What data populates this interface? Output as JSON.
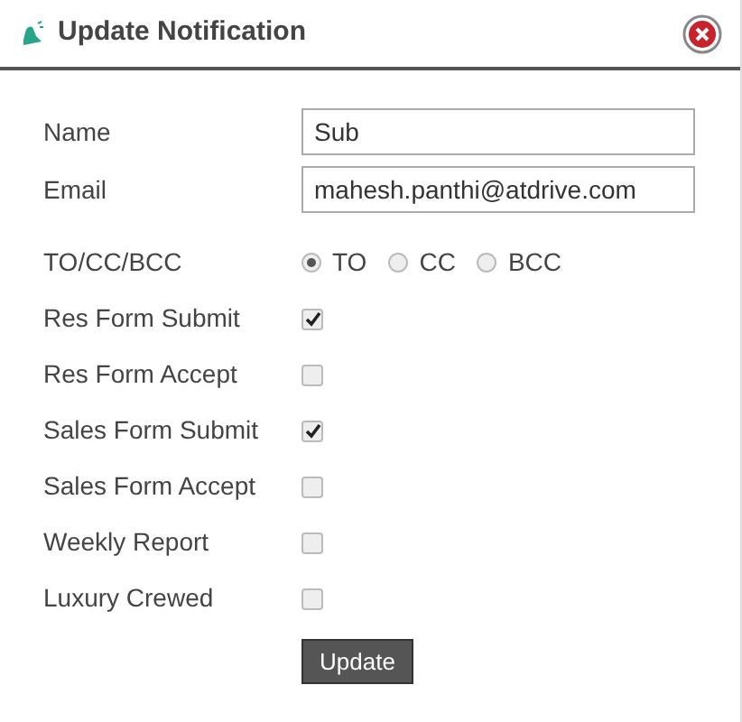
{
  "dialog": {
    "title": "Update Notification"
  },
  "fields": [
    {
      "label": "Name",
      "value": "Sub"
    },
    {
      "label": "Email",
      "value": "mahesh.panthi@atdrive.com"
    }
  ],
  "recipient": {
    "label": "TO/CC/BCC",
    "options": [
      {
        "label": "TO",
        "selected": true
      },
      {
        "label": "CC",
        "selected": false
      },
      {
        "label": "BCC",
        "selected": false
      }
    ]
  },
  "options": [
    {
      "label": "Res Form Submit",
      "checked": true
    },
    {
      "label": "Res Form Accept",
      "checked": false
    },
    {
      "label": "Sales Form Submit",
      "checked": true
    },
    {
      "label": "Sales Form Accept",
      "checked": false
    },
    {
      "label": "Weekly Report",
      "checked": false
    },
    {
      "label": "Luxury Crewed",
      "checked": false
    }
  ],
  "button": "Update"
}
